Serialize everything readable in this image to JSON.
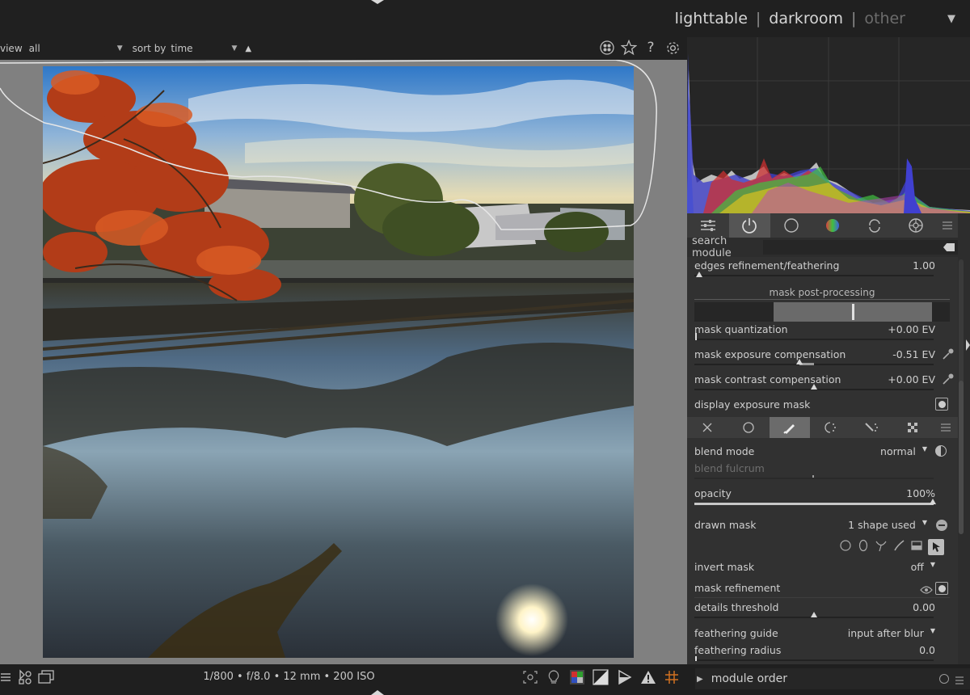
{
  "views": {
    "lighttable": "lighttable",
    "darkroom": "darkroom",
    "other": "other",
    "sep1": "|",
    "sep2": "|",
    "dropdown": "▼"
  },
  "filter": {
    "view_label": "view",
    "view_value": "all",
    "sort_label": "sort by",
    "sort_value": "time",
    "sort_dir": "▲",
    "dd_arrow": "▼"
  },
  "top_icons": [
    "color-labels-icon",
    "star-icon",
    "help-icon",
    "gear-icon"
  ],
  "top_help": "?",
  "module_tabs": [
    "quick-access-icon",
    "active-modules-icon",
    "base-modules-icon",
    "color-modules-icon",
    "correct-modules-icon",
    "effect-modules-icon",
    "presets-menu-icon"
  ],
  "search": {
    "label": "search module",
    "value": ""
  },
  "params": {
    "edges": {
      "label": "edges refinement/feathering",
      "value": "1.00"
    },
    "post_title": "mask post-processing",
    "quant": {
      "label": "mask quantization",
      "value": "+0.00 EV"
    },
    "expo": {
      "label": "mask exposure compensation",
      "value": "-0.51 EV"
    },
    "contrast": {
      "label": "mask contrast compensation",
      "value": "+0.00 EV"
    },
    "display": {
      "label": "display exposure mask"
    }
  },
  "blend": {
    "mode_label": "blend mode",
    "mode_value": "normal",
    "mode_arrow": "▼",
    "fulcrum_label": "blend fulcrum",
    "opacity_label": "opacity",
    "opacity_value": "100%",
    "drawn_label": "drawn mask",
    "drawn_value": "1 shape used",
    "drawn_arrow": "▼",
    "invert_label": "invert mask",
    "invert_value": "off",
    "invert_arrow": "▼",
    "refine_label": "mask refinement",
    "details_label": "details threshold",
    "details_value": "0.00",
    "guide_label": "feathering guide",
    "guide_value": "input after blur",
    "guide_arrow": "▼",
    "radius_label": "feathering radius",
    "radius_value": "0.0"
  },
  "levels": {
    "opacity": 1.0,
    "details": 0.5,
    "quant": 0.0,
    "expo": 0.44,
    "contrast": 0.5,
    "edges": 0.02,
    "post_handle": 0.51
  },
  "exif": "1/800 • f/8.0 • 12 mm • 200 ISO",
  "bottom_icons": [
    "focus-peaking-icon",
    "lightbulb-icon",
    "color-assessment-icon",
    "overexposed-icon",
    "softproof-icon",
    "gamut-check-icon",
    "guides-icon"
  ],
  "module_order": {
    "label": "module order",
    "arrow": "▶"
  },
  "colors": {
    "accent": "#d6d6d6",
    "gamut_warning": "#e0a020",
    "guides": "#d07020"
  }
}
